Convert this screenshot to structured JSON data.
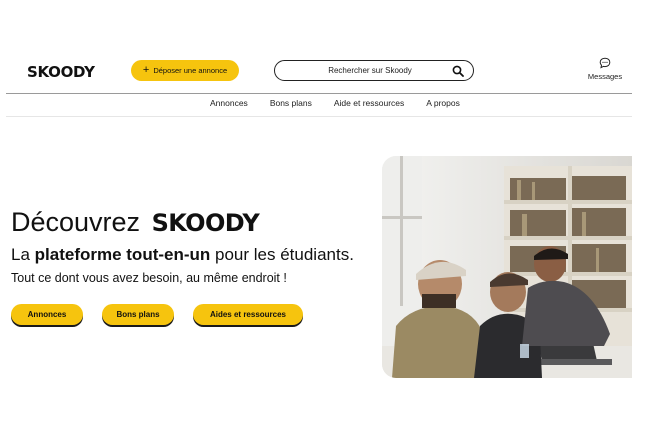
{
  "header": {
    "logo": "SKOODY",
    "post_button_label": "Déposer une annonce",
    "search_placeholder": "Rechercher sur Skoody",
    "messages_label": "Messages"
  },
  "nav": {
    "items": [
      "Annonces",
      "Bons plans",
      "Aide et ressources",
      "A propos"
    ]
  },
  "hero": {
    "title_prefix": "Découvrez",
    "title_brand": "SKOODY",
    "subtitle_start": "La ",
    "subtitle_bold": "plateforme tout-en-un",
    "subtitle_end": " pour les étudiants.",
    "tagline": "Tout ce dont vous avez besoin, au même endroit !",
    "buttons": [
      "Annonces",
      "Bons plans",
      "Aides et ressources"
    ]
  },
  "colors": {
    "accent": "#f6c40e",
    "text": "#111111"
  }
}
